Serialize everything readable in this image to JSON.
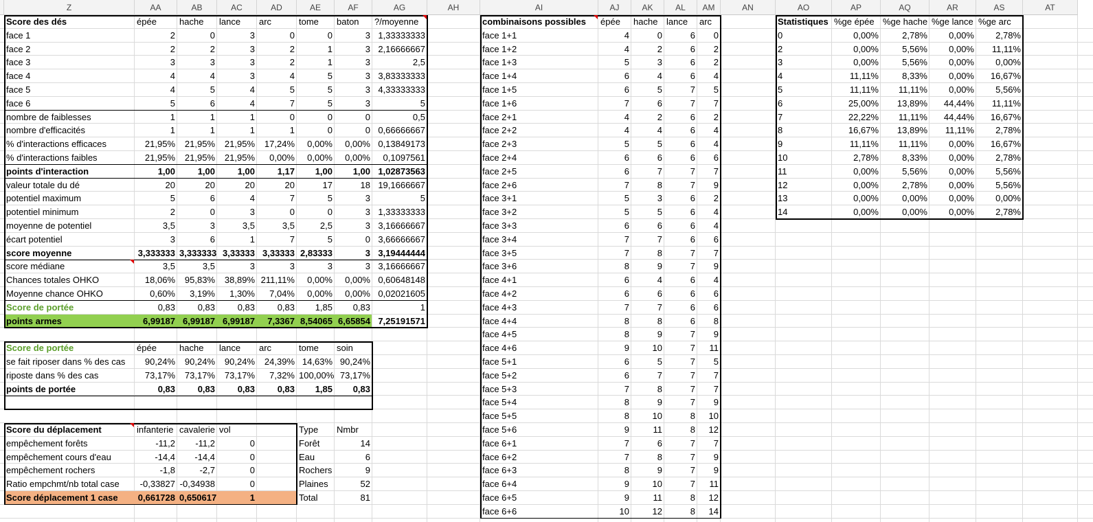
{
  "columns": [
    {
      "key": "Z",
      "label": "Z"
    },
    {
      "key": "AA",
      "label": "AA"
    },
    {
      "key": "AB",
      "label": "AB"
    },
    {
      "key": "AC",
      "label": "AC"
    },
    {
      "key": "AD",
      "label": "AD"
    },
    {
      "key": "AE",
      "label": "AE"
    },
    {
      "key": "AF",
      "label": "AF"
    },
    {
      "key": "AG",
      "label": "AG"
    },
    {
      "key": "AH",
      "label": "AH"
    },
    {
      "key": "AI",
      "label": "AI"
    },
    {
      "key": "AJ",
      "label": "AJ"
    },
    {
      "key": "AK",
      "label": "AK"
    },
    {
      "key": "AL",
      "label": "AL"
    },
    {
      "key": "AM",
      "label": "AM"
    },
    {
      "key": "AN",
      "label": "AN"
    },
    {
      "key": "AO",
      "label": "AO"
    },
    {
      "key": "AP",
      "label": "AP"
    },
    {
      "key": "AQ",
      "label": "AQ"
    },
    {
      "key": "AR",
      "label": "AR"
    },
    {
      "key": "AS",
      "label": "AS"
    },
    {
      "key": "AT",
      "label": "AT"
    }
  ],
  "colors": {
    "green_fill": "#92d050",
    "orange_fill": "#f4b183",
    "green_text": "#5a9e2a",
    "comment_marker": "#e00000"
  },
  "dice_table": {
    "header": [
      "Score des dés",
      "épée",
      "hache",
      "lance",
      "arc",
      "tome",
      "baton",
      "?/moyenne"
    ],
    "rows": [
      [
        "face 1",
        "2",
        "0",
        "3",
        "0",
        "0",
        "3",
        "1,33333333"
      ],
      [
        "face 2",
        "2",
        "2",
        "3",
        "2",
        "1",
        "3",
        "2,16666667"
      ],
      [
        "face 3",
        "3",
        "3",
        "3",
        "2",
        "1",
        "3",
        "2,5"
      ],
      [
        "face 4",
        "4",
        "4",
        "3",
        "4",
        "5",
        "3",
        "3,83333333"
      ],
      [
        "face 5",
        "4",
        "5",
        "4",
        "5",
        "5",
        "3",
        "4,33333333"
      ],
      [
        "face 6",
        "5",
        "6",
        "4",
        "7",
        "5",
        "3",
        "5"
      ],
      [
        "nombre de faiblesses",
        "1",
        "1",
        "1",
        "0",
        "0",
        "0",
        "0,5"
      ],
      [
        "nombre d'efficacités",
        "1",
        "1",
        "1",
        "1",
        "0",
        "0",
        "0,66666667"
      ],
      [
        "% d'interactions efficaces",
        "21,95%",
        "21,95%",
        "21,95%",
        "17,24%",
        "0,00%",
        "0,00%",
        "0,13849173"
      ],
      [
        "% d'interactions faibles",
        "21,95%",
        "21,95%",
        "21,95%",
        "0,00%",
        "0,00%",
        "0,00%",
        "0,1097561"
      ],
      [
        "points d'interaction",
        "1,00",
        "1,00",
        "1,00",
        "1,17",
        "1,00",
        "1,00",
        "1,02873563"
      ],
      [
        "valeur totale du dé",
        "20",
        "20",
        "20",
        "20",
        "17",
        "18",
        "19,1666667"
      ],
      [
        "potentiel maximum",
        "5",
        "6",
        "4",
        "7",
        "5",
        "3",
        "5"
      ],
      [
        "potentiel minimum",
        "2",
        "0",
        "3",
        "0",
        "0",
        "3",
        "1,33333333"
      ],
      [
        "moyenne de potentiel",
        "3,5",
        "3",
        "3,5",
        "3,5",
        "2,5",
        "3",
        "3,16666667"
      ],
      [
        "écart potentiel",
        "3",
        "6",
        "1",
        "7",
        "5",
        "0",
        "3,66666667"
      ],
      [
        "score moyenne",
        "3,333333",
        "3,333333",
        "3,33333",
        "3,33333",
        "2,83333",
        "3",
        "3,19444444"
      ],
      [
        "score médiane",
        "3,5",
        "3,5",
        "3",
        "3",
        "3",
        "3",
        "3,16666667"
      ],
      [
        "Chances totales OHKO",
        "18,06%",
        "95,83%",
        "38,89%",
        "211,11%",
        "0,00%",
        "0,00%",
        "0,60648148"
      ],
      [
        "Moyenne chance OHKO",
        "0,60%",
        "3,19%",
        "1,30%",
        "7,04%",
        "0,00%",
        "0,00%",
        "0,02021605"
      ],
      [
        "Score de portée",
        "0,83",
        "0,83",
        "0,83",
        "0,83",
        "1,85",
        "0,83",
        "1"
      ],
      [
        "points armes",
        "6,99187",
        "6,99187",
        "6,99187",
        "7,3367",
        "8,54065",
        "6,65854",
        "7,25191571"
      ]
    ]
  },
  "range_table": {
    "header": [
      "Score de portée",
      "épée",
      "hache",
      "lance",
      "arc",
      "tome",
      "soin"
    ],
    "rows": [
      [
        "se fait riposer dans % des cas",
        "90,24%",
        "90,24%",
        "90,24%",
        "24,39%",
        "14,63%",
        "90,24%"
      ],
      [
        "riposte dans % des cas",
        "73,17%",
        "73,17%",
        "73,17%",
        "7,32%",
        "100,00%",
        "73,17%"
      ],
      [
        "points de portée",
        "0,83",
        "0,83",
        "0,83",
        "0,83",
        "1,85",
        "0,83"
      ]
    ]
  },
  "move_table": {
    "header": [
      "Score du déplacement",
      "infanterie",
      "cavalerie",
      "vol"
    ],
    "rows": [
      [
        "empêchement forêts",
        "-11,2",
        "-11,2",
        "0"
      ],
      [
        "empêchement cours d'eau",
        "-14,4",
        "-14,4",
        "0"
      ],
      [
        "empêchement rochers",
        "-1,8",
        "-2,7",
        "0"
      ],
      [
        "Ratio empchmt/nb total case",
        "-0,33827",
        "-0,34938",
        "0"
      ],
      [
        "Score déplacement 1 case",
        "0,661728",
        "0,650617",
        "1"
      ]
    ]
  },
  "terrain_table": {
    "header": [
      "Type",
      "Nmbr"
    ],
    "rows": [
      [
        "Forêt",
        "14"
      ],
      [
        "Eau",
        "6"
      ],
      [
        "Rochers",
        "9"
      ],
      [
        "Plaines",
        "52"
      ],
      [
        "Total",
        "81"
      ]
    ]
  },
  "combo_table": {
    "header": [
      "combinaisons possibles",
      "épée",
      "hache",
      "lance",
      "arc"
    ],
    "rows": [
      [
        "face 1+1",
        "4",
        "0",
        "6",
        "0"
      ],
      [
        "face 1+2",
        "4",
        "2",
        "6",
        "2"
      ],
      [
        "face 1+3",
        "5",
        "3",
        "6",
        "2"
      ],
      [
        "face 1+4",
        "6",
        "4",
        "6",
        "4"
      ],
      [
        "face 1+5",
        "6",
        "5",
        "7",
        "5"
      ],
      [
        "face 1+6",
        "7",
        "6",
        "7",
        "7"
      ],
      [
        "face 2+1",
        "4",
        "2",
        "6",
        "2"
      ],
      [
        "face 2+2",
        "4",
        "4",
        "6",
        "4"
      ],
      [
        "face 2+3",
        "5",
        "5",
        "6",
        "4"
      ],
      [
        "face 2+4",
        "6",
        "6",
        "6",
        "6"
      ],
      [
        "face 2+5",
        "6",
        "7",
        "7",
        "7"
      ],
      [
        "face 2+6",
        "7",
        "8",
        "7",
        "9"
      ],
      [
        "face 3+1",
        "5",
        "3",
        "6",
        "2"
      ],
      [
        "face 3+2",
        "5",
        "5",
        "6",
        "4"
      ],
      [
        "face 3+3",
        "6",
        "6",
        "6",
        "4"
      ],
      [
        "face 3+4",
        "7",
        "7",
        "6",
        "6"
      ],
      [
        "face 3+5",
        "7",
        "8",
        "7",
        "7"
      ],
      [
        "face 3+6",
        "8",
        "9",
        "7",
        "9"
      ],
      [
        "face 4+1",
        "6",
        "4",
        "6",
        "4"
      ],
      [
        "face 4+2",
        "6",
        "6",
        "6",
        "6"
      ],
      [
        "face 4+3",
        "7",
        "7",
        "6",
        "6"
      ],
      [
        "face 4+4",
        "8",
        "8",
        "6",
        "8"
      ],
      [
        "face 4+5",
        "8",
        "9",
        "7",
        "9"
      ],
      [
        "face 4+6",
        "9",
        "10",
        "7",
        "11"
      ],
      [
        "face 5+1",
        "6",
        "5",
        "7",
        "5"
      ],
      [
        "face 5+2",
        "6",
        "7",
        "7",
        "7"
      ],
      [
        "face 5+3",
        "7",
        "8",
        "7",
        "7"
      ],
      [
        "face 5+4",
        "8",
        "9",
        "7",
        "9"
      ],
      [
        "face 5+5",
        "8",
        "10",
        "8",
        "10"
      ],
      [
        "face 5+6",
        "9",
        "11",
        "8",
        "12"
      ],
      [
        "face 6+1",
        "7",
        "6",
        "7",
        "7"
      ],
      [
        "face 6+2",
        "7",
        "8",
        "7",
        "9"
      ],
      [
        "face 6+3",
        "8",
        "9",
        "7",
        "9"
      ],
      [
        "face 6+4",
        "9",
        "10",
        "7",
        "11"
      ],
      [
        "face 6+5",
        "9",
        "11",
        "8",
        "12"
      ],
      [
        "face 6+6",
        "10",
        "12",
        "8",
        "14"
      ]
    ]
  },
  "stats_table": {
    "header": [
      "Statistiques",
      "%ge épée",
      "%ge hache",
      "%ge lance",
      "%ge arc"
    ],
    "rows": [
      [
        "0",
        "0,00%",
        "2,78%",
        "0,00%",
        "2,78%"
      ],
      [
        "2",
        "0,00%",
        "5,56%",
        "0,00%",
        "11,11%"
      ],
      [
        "3",
        "0,00%",
        "5,56%",
        "0,00%",
        "0,00%"
      ],
      [
        "4",
        "11,11%",
        "8,33%",
        "0,00%",
        "16,67%"
      ],
      [
        "5",
        "11,11%",
        "11,11%",
        "0,00%",
        "5,56%"
      ],
      [
        "6",
        "25,00%",
        "13,89%",
        "44,44%",
        "11,11%"
      ],
      [
        "7",
        "22,22%",
        "11,11%",
        "44,44%",
        "16,67%"
      ],
      [
        "8",
        "16,67%",
        "13,89%",
        "11,11%",
        "2,78%"
      ],
      [
        "9",
        "11,11%",
        "11,11%",
        "0,00%",
        "16,67%"
      ],
      [
        "10",
        "2,78%",
        "8,33%",
        "0,00%",
        "2,78%"
      ],
      [
        "11",
        "0,00%",
        "5,56%",
        "0,00%",
        "5,56%"
      ],
      [
        "12",
        "0,00%",
        "2,78%",
        "0,00%",
        "5,56%"
      ],
      [
        "13",
        "0,00%",
        "0,00%",
        "0,00%",
        "0,00%"
      ],
      [
        "14",
        "0,00%",
        "0,00%",
        "0,00%",
        "2,78%"
      ]
    ]
  }
}
